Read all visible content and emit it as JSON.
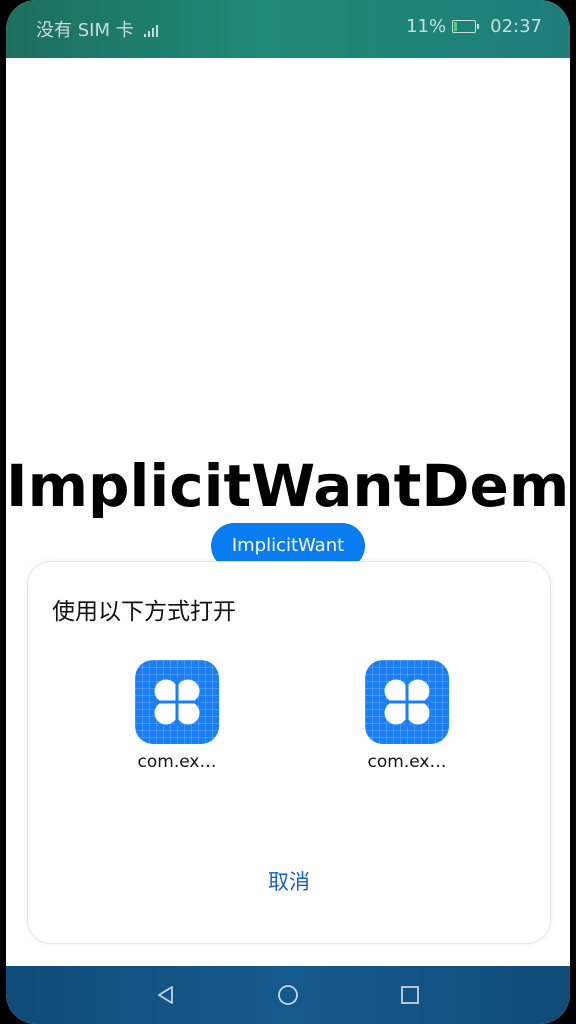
{
  "status_bar": {
    "carrier": "没有 SIM 卡",
    "battery": "11%",
    "time": "02:37"
  },
  "main": {
    "title": "ImplicitWantDemo",
    "button_label": "ImplicitWant"
  },
  "dialog": {
    "title": "使用以下方式打开",
    "apps": [
      {
        "label": "com.ex…",
        "icon": "app-icon"
      },
      {
        "label": "com.ex…",
        "icon": "app-icon"
      }
    ],
    "cancel_label": "取消"
  },
  "nav_bar": {
    "buttons": [
      "back-icon",
      "home-icon",
      "recents-icon"
    ]
  },
  "colors": {
    "accent": "#0a7cf2",
    "app_icon": "#1a7ef5",
    "cancel_text": "#1a5fd1"
  }
}
